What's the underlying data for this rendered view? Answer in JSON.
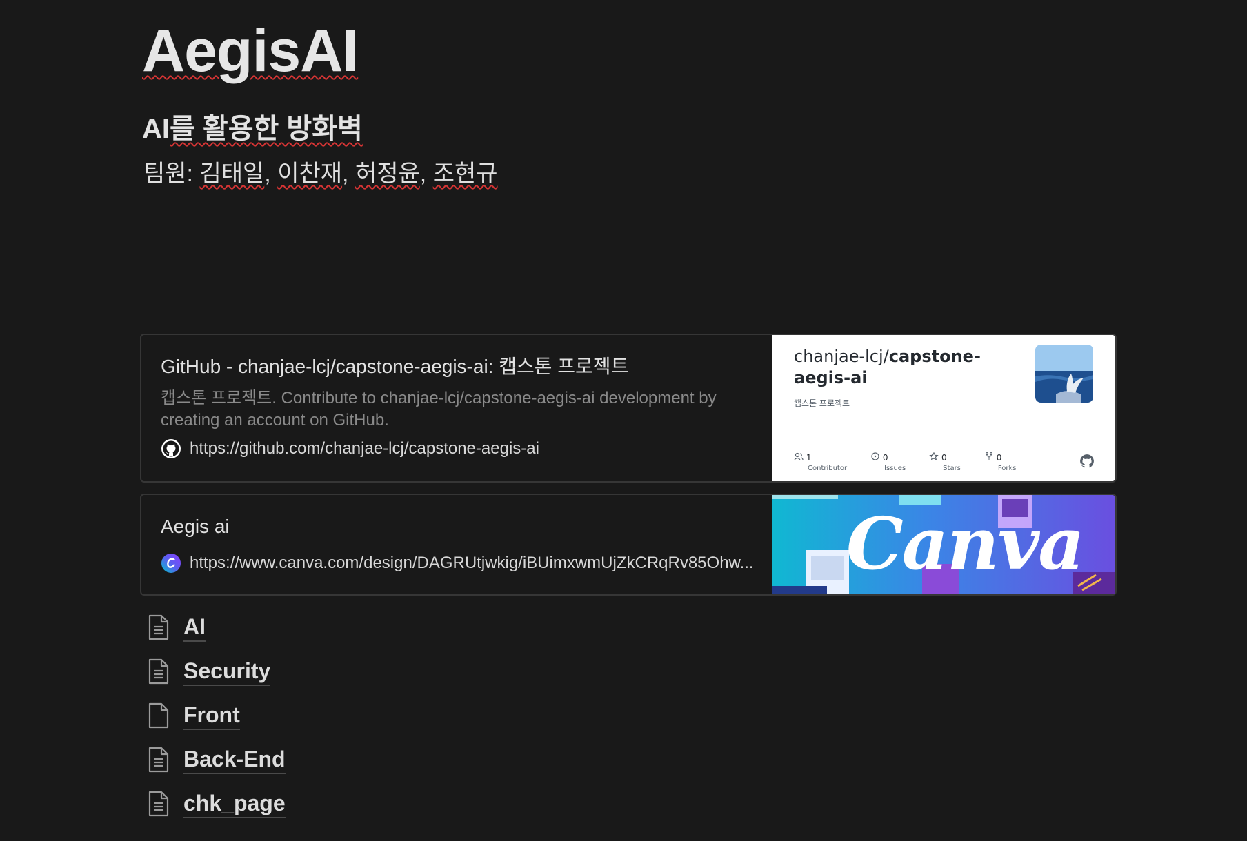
{
  "page": {
    "title": "AegisAI",
    "subtitle_ai": "AI",
    "subtitle_rest": "를 활용한 방화벽",
    "members_prefix": "팀원: ",
    "members": [
      "김태일",
      "이찬재",
      "허정윤",
      "조현규"
    ],
    "member_sep": ", "
  },
  "bookmarks": [
    {
      "title": "GitHub - chanjae-lcj/capstone-aegis-ai: 캡스톤 프로젝트",
      "description": "캡스톤 프로젝트. Contribute to chanjae-lcj/capstone-aegis-ai development by creating an account on GitHub.",
      "url": "https://github.com/chanjae-lcj/capstone-aegis-ai",
      "favicon": "github-icon",
      "preview": {
        "owner": "chanjae-lcj/",
        "repo": "capstone-aegis-ai",
        "desc": "캡스톤 프로젝트",
        "stats": [
          {
            "icon": "contributors-icon",
            "value": "1",
            "label": "Contributor"
          },
          {
            "icon": "issues-icon",
            "value": "0",
            "label": "Issues"
          },
          {
            "icon": "star-icon",
            "value": "0",
            "label": "Stars"
          },
          {
            "icon": "fork-icon",
            "value": "0",
            "label": "Forks"
          }
        ]
      }
    },
    {
      "title": "Aegis ai",
      "url": "https://www.canva.com/design/DAGRUtjwkig/iBUimxwmUjZkCRqRv85Ohw...",
      "favicon": "canva-icon",
      "preview": {
        "word": "Canva"
      }
    }
  ],
  "subpages": [
    {
      "label": "AI",
      "icon": "page-text-icon"
    },
    {
      "label": "Security",
      "icon": "page-text-icon"
    },
    {
      "label": "Front",
      "icon": "page-blank-icon"
    },
    {
      "label": "Back-End",
      "icon": "page-text-icon"
    },
    {
      "label": "chk_page",
      "icon": "page-text-icon"
    }
  ],
  "colors": {
    "background": "#191919",
    "text": "#d4d4d4",
    "spellcheck": "#d63434"
  }
}
